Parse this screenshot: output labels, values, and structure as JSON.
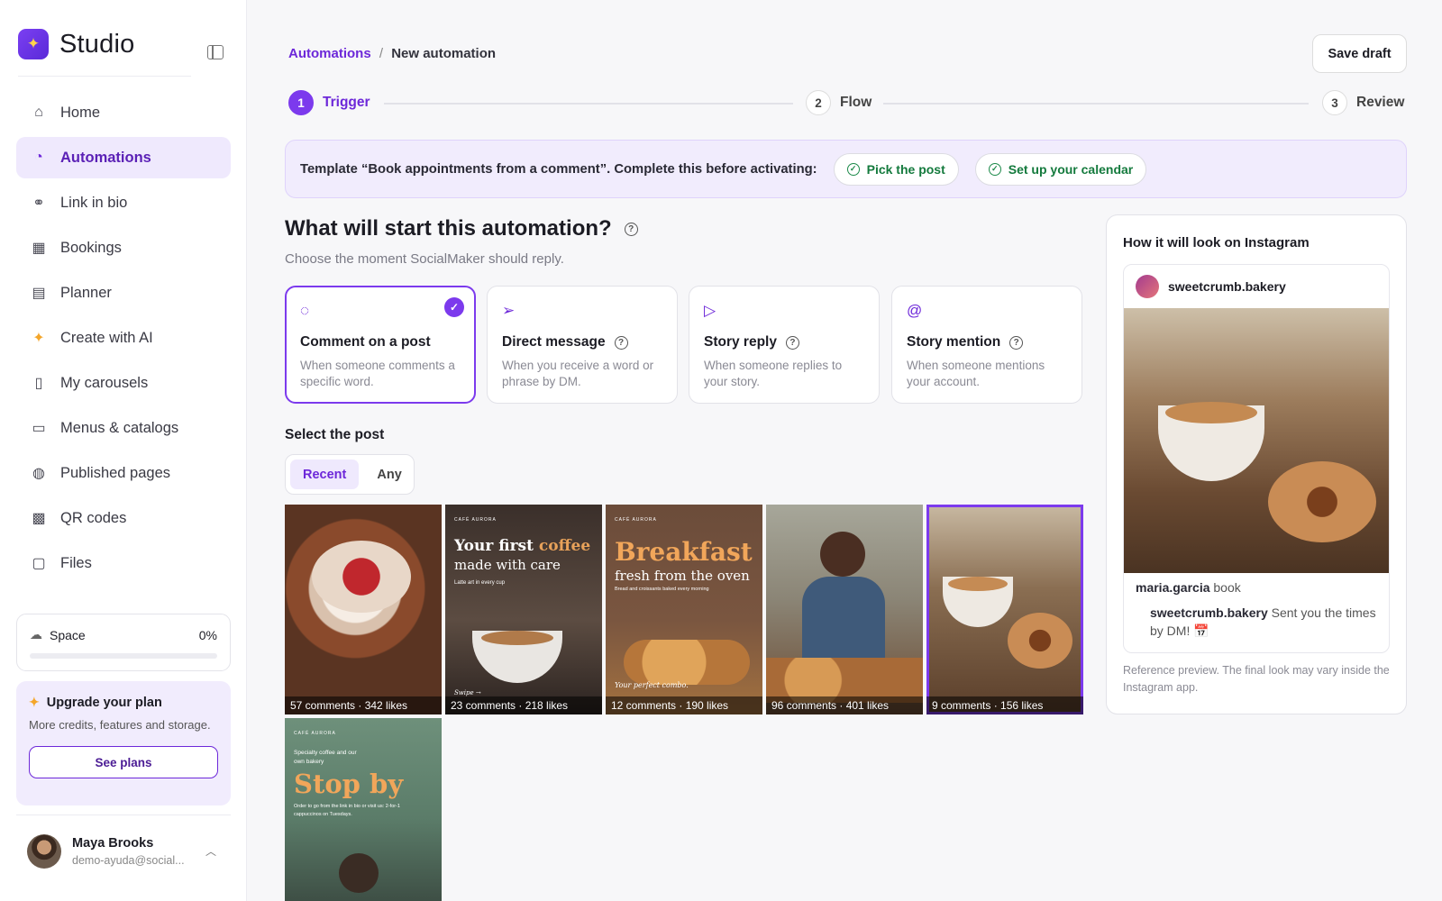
{
  "app": {
    "name": "Studio"
  },
  "sidebar": {
    "items": [
      {
        "label": "Home",
        "icon": "home-icon"
      },
      {
        "label": "Automations",
        "icon": "chat-bubble-icon",
        "active": true
      },
      {
        "label": "Link in bio",
        "icon": "link-icon"
      },
      {
        "label": "Bookings",
        "icon": "calendar-check-icon"
      },
      {
        "label": "Planner",
        "icon": "calendar-icon"
      },
      {
        "label": "Create with AI",
        "icon": "sparkle-icon"
      },
      {
        "label": "My carousels",
        "icon": "carousel-icon"
      },
      {
        "label": "Menus & catalogs",
        "icon": "document-icon"
      },
      {
        "label": "Published pages",
        "icon": "globe-icon"
      },
      {
        "label": "QR codes",
        "icon": "qr-code-icon"
      },
      {
        "label": "Files",
        "icon": "folder-icon"
      }
    ],
    "space": {
      "label": "Space",
      "percent_text": "0%",
      "percent": 0
    },
    "upgrade": {
      "title": "Upgrade your plan",
      "description": "More credits, features and storage.",
      "button": "See plans"
    },
    "user": {
      "name": "Maya Brooks",
      "email": "demo-ayuda@social..."
    }
  },
  "header": {
    "breadcrumb": {
      "parent": "Automations",
      "separator": "/",
      "current": "New automation"
    },
    "save_draft": "Save draft"
  },
  "steps": [
    {
      "num": "1",
      "label": "Trigger",
      "active": true
    },
    {
      "num": "2",
      "label": "Flow"
    },
    {
      "num": "3",
      "label": "Review"
    }
  ],
  "banner": {
    "text": "Template “Book appointments from a comment”. Complete this before activating:",
    "pills": [
      "Pick the post",
      "Set up your calendar"
    ]
  },
  "section": {
    "title": "What will start this automation?",
    "subtitle": "Choose the moment SocialMaker should reply."
  },
  "triggers": [
    {
      "title": "Comment on a post",
      "desc": "When someone comments a specific word.",
      "icon": "comment-icon",
      "selected": true
    },
    {
      "title": "Direct message",
      "desc": "When you receive a word or phrase by DM.",
      "icon": "send-icon",
      "help": true
    },
    {
      "title": "Story reply",
      "desc": "When someone replies to your story.",
      "icon": "play-icon",
      "help": true
    },
    {
      "title": "Story mention",
      "desc": "When someone mentions your account.",
      "icon": "at-icon",
      "help": true
    }
  ],
  "post_select": {
    "label": "Select the post",
    "tabs": [
      "Recent",
      "Any"
    ],
    "active_tab": "Recent"
  },
  "posts": [
    {
      "stats": "57 comments · 342 likes"
    },
    {
      "stats": "23 comments · 218 likes",
      "brand": "CAFÉ AURORA",
      "headline_a": "Your first",
      "headline_b": "coffee",
      "headline_c": "made with care",
      "tagline": "Latte art in every cup",
      "footer": "Swipe →"
    },
    {
      "stats": "12 comments · 190 likes",
      "brand": "CAFÉ AURORA",
      "headline_a": "Breakfast",
      "headline_b": "fresh from the oven",
      "tagline": "Bread and croissants baked every morning",
      "footer": "Your perfect combo."
    },
    {
      "stats": "96 comments · 401 likes"
    },
    {
      "stats": "9 comments · 156 likes",
      "selected": true
    },
    {
      "stats": "",
      "brand": "CAFÉ AURORA",
      "kicker": "Specialty coffee and our own bakery",
      "headline_a": "Stop by",
      "tagline": "Order to go from the link in bio or visit us: 2-for-1 cappuccinos on Tuesdays."
    }
  ],
  "preview": {
    "title": "How it will look on Instagram",
    "account": "sweetcrumb.bakery",
    "comment_user": "maria.garcia",
    "comment_text": "book",
    "reply_user": "sweetcrumb.bakery",
    "reply_text": "Sent you the times by DM! 📅",
    "note": "Reference preview. The final look may vary inside the Instagram app."
  },
  "colors": {
    "accent": "#7c3aed",
    "accent_soft": "#efe9fd",
    "success": "#147a3d"
  }
}
